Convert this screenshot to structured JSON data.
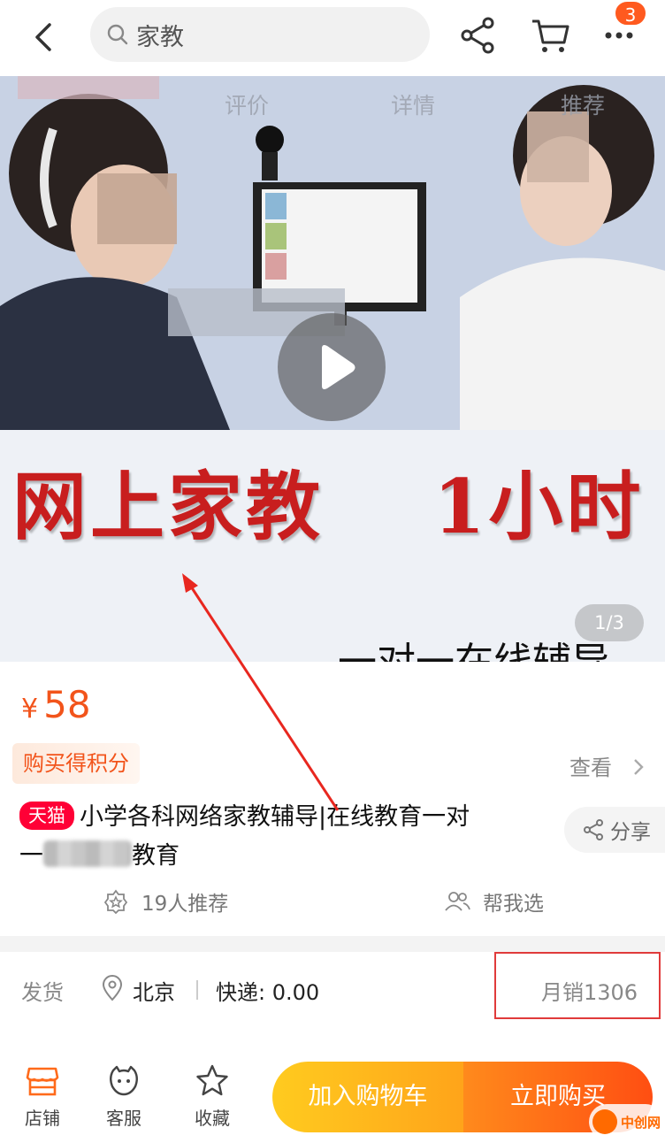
{
  "search": {
    "query": "家教"
  },
  "topbar": {
    "cart_badge": "3"
  },
  "hero": {
    "tabs": [
      "评价",
      "详情",
      "推荐"
    ],
    "headline": "网上家教",
    "headline_right": "1小时",
    "subline": "一对一在线辅导",
    "page_indicator": "1/3"
  },
  "product": {
    "currency": "¥",
    "price": "58",
    "points_tag": "购买得积分",
    "view_link": "查看",
    "tmall_badge": "天猫",
    "title_line1": "小学各科网络家教辅导|在线教育一对",
    "title_line2_prefix": "一",
    "title_line2_suffix": "教育",
    "share_label": "分享",
    "recommend_label": "19人推荐",
    "help_choose_label": "帮我选"
  },
  "shipping": {
    "label": "发货",
    "location": "北京",
    "express": "快递: 0.00",
    "monthly_sales": "月销1306"
  },
  "bottom_bar": {
    "store": "店铺",
    "service": "客服",
    "favorite": "收藏",
    "add_to_cart": "加入购物车",
    "buy_now": "立即购买"
  },
  "watermark": {
    "text": "中创网"
  },
  "colors": {
    "accent": "#f2541b",
    "tmall": "#ff0036",
    "cart_button": "#ffa41a",
    "buy_button": "#ff4e12"
  }
}
